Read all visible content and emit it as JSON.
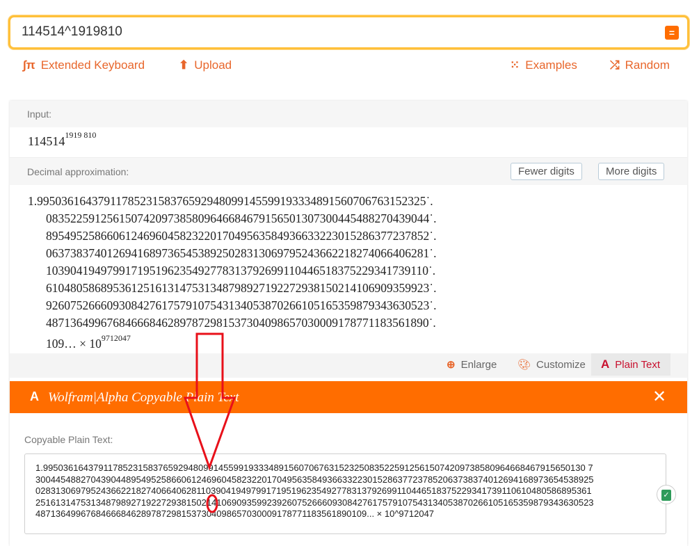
{
  "search": {
    "value": "114514^1919810",
    "submit_icon": "equals-icon"
  },
  "links": {
    "extended_keyboard": "Extended Keyboard",
    "upload": "Upload",
    "examples": "Examples",
    "random": "Random"
  },
  "input_pod": {
    "label": "Input:",
    "base": "114514",
    "exponent": "1919 810"
  },
  "decimal_pod": {
    "label": "Decimal approximation:",
    "fewer": "Fewer digits",
    "more": "More digits",
    "lines": [
      "1.9950361643791178523158376592948099145599193334891560706763152325",
      "083522591256150742097385809646684679156501307300445488270439044",
      "895495258660612469604582322017049563584936633223015286377237852",
      "063738374012694168973654538925028313069795243662218274066406281",
      "103904194979917195196235492778313792699110446518375229341739110",
      "610480586895361251613147531348798927192272938150214106909359923",
      "926075266609308427617579107543134053870266105165359879343630523",
      "487136499676846668462897872981537304098657030009178771183561890"
    ],
    "last_line": "109… × 10",
    "exponent": "9712047"
  },
  "toolbar": {
    "enlarge": "Enlarge",
    "customize": "Customize",
    "plain_text": "Plain Text"
  },
  "plain_text_popup": {
    "title": "Wolfram|Alpha Copyable Plain Text",
    "label": "Copyable Plain Text:",
    "text": "1.995036164379117852315837659294809914559919333489156070676315232508352259125615074209738580964668467915650130 7\n300445488270439044895495258660612469604582322017049563584936633223015286377237852063738374012694168973654538925\n028313069795243662218274066406281103904194979917195196235492778313792699110446518375229341739110610480586895361\n251613147531348798927192272938150214106909359923926075266609308427617579107543134053870266105165359879343630523\n487136499676846668462897872981537304098657030009178771183561890109... × 10^9712047"
  },
  "colors": {
    "accent": "#ff6d00",
    "link": "#e8662b",
    "annotation": "#e8101a"
  }
}
